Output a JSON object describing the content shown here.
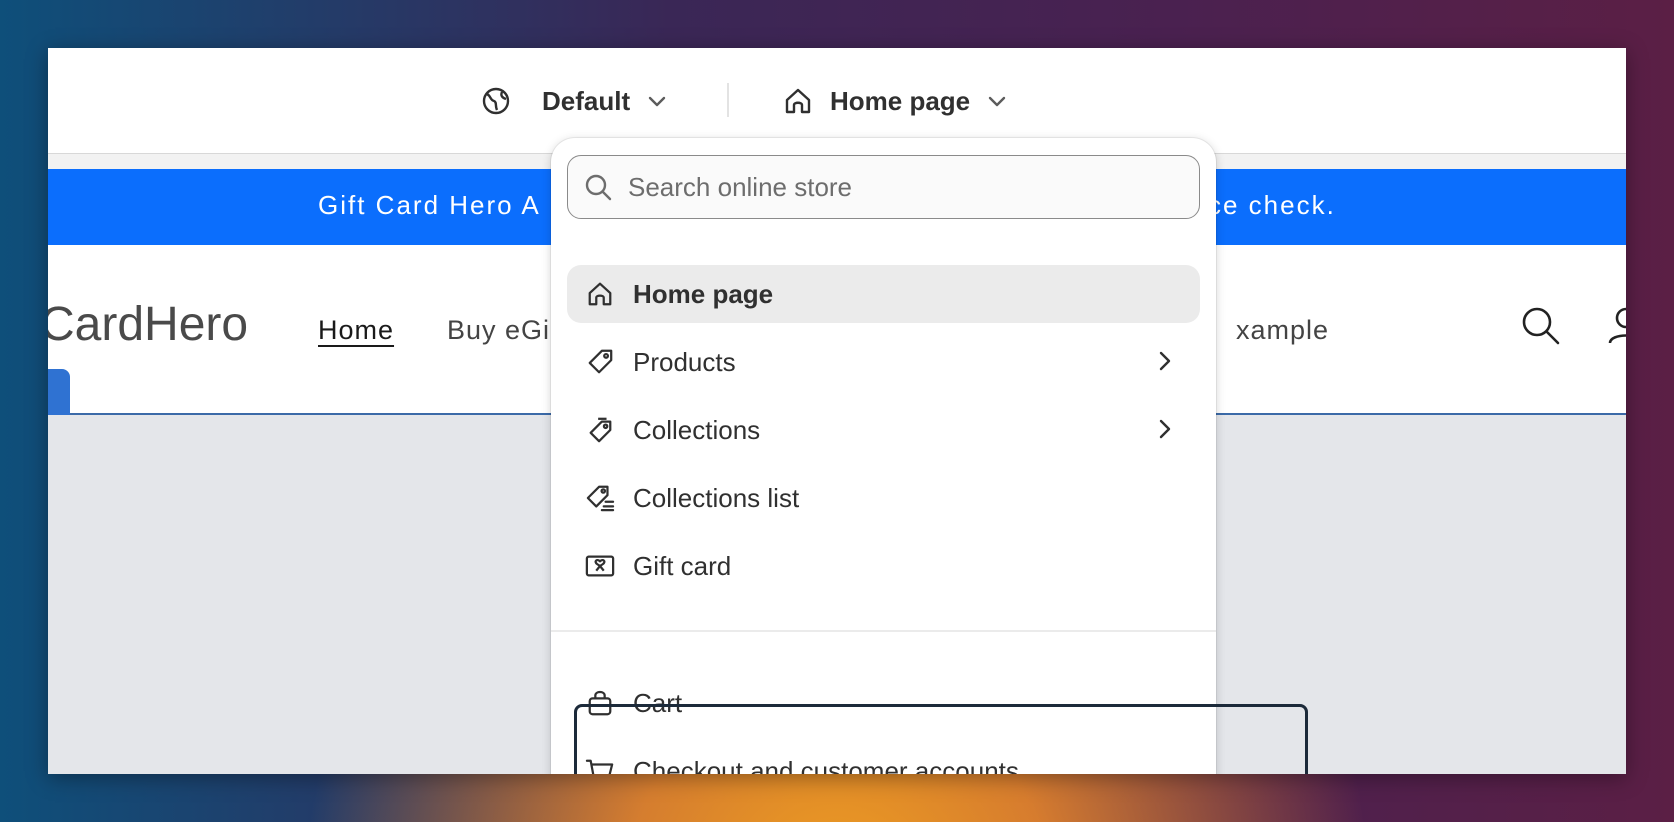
{
  "toolbar": {
    "theme_label": "Default",
    "template_label": "Home page"
  },
  "banner": {
    "left_text": "Gift Card Hero A",
    "right_text": "ce check."
  },
  "store": {
    "logo_text": "CardHero",
    "nav": [
      {
        "label": "Home"
      },
      {
        "label": "Buy eGi"
      },
      {
        "label": "xample"
      }
    ]
  },
  "dropdown": {
    "search_placeholder": "Search online store",
    "items": [
      {
        "label": "Home page",
        "icon": "home-icon"
      },
      {
        "label": "Products",
        "icon": "tag-icon"
      },
      {
        "label": "Collections",
        "icon": "tags-icon"
      },
      {
        "label": "Collections list",
        "icon": "tags-list-icon"
      },
      {
        "label": "Gift card",
        "icon": "gift-card-icon"
      },
      {
        "label": "Cart",
        "icon": "bag-icon"
      },
      {
        "label": "Checkout and customer accounts",
        "icon": "cart-icon"
      }
    ]
  },
  "colors": {
    "banner": "#0b6efd",
    "selected_item_bg": "#ebebeb",
    "text": "#303030"
  }
}
